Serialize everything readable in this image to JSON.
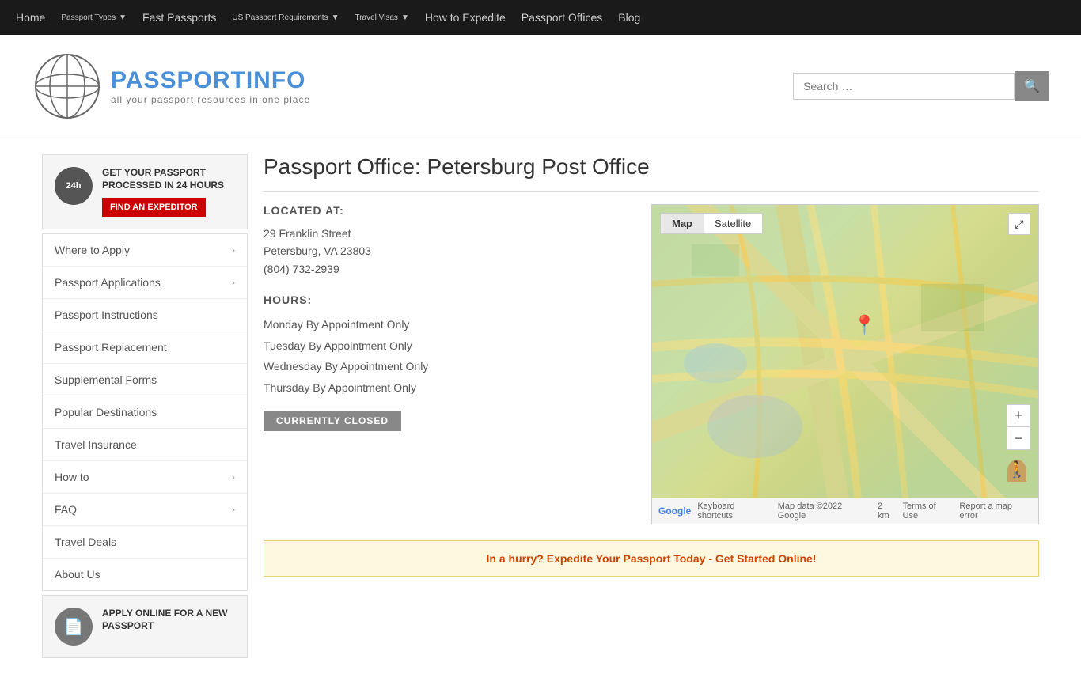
{
  "nav": {
    "items": [
      {
        "label": "Home",
        "hasDropdown": false
      },
      {
        "label": "Passport Types",
        "hasDropdown": true
      },
      {
        "label": "Fast Passports",
        "hasDropdown": false
      },
      {
        "label": "US Passport Requirements",
        "hasDropdown": true
      },
      {
        "label": "Travel Visas",
        "hasDropdown": true
      },
      {
        "label": "How to Expedite",
        "hasDropdown": false
      },
      {
        "label": "Passport Offices",
        "hasDropdown": false
      },
      {
        "label": "Blog",
        "hasDropdown": false
      }
    ]
  },
  "header": {
    "logo_text_1": "PASSPORT",
    "logo_text_2": "INFO",
    "logo_sub": "all your passport resources in one place",
    "search_placeholder": "Search …"
  },
  "sidebar": {
    "promo": {
      "title": "GET YOUR PASSPORT PROCESSED IN 24 HOURS",
      "button": "FIND AN EXPEDITOR"
    },
    "menu_items": [
      {
        "label": "Where to Apply",
        "hasDropdown": true
      },
      {
        "label": "Passport Applications",
        "hasDropdown": true
      },
      {
        "label": "Passport Instructions",
        "hasDropdown": false
      },
      {
        "label": "Passport Replacement",
        "hasDropdown": false
      },
      {
        "label": "Supplemental Forms",
        "hasDropdown": false
      },
      {
        "label": "Popular Destinations",
        "hasDropdown": false
      },
      {
        "label": "Travel Insurance",
        "hasDropdown": false
      },
      {
        "label": "How to",
        "hasDropdown": true
      },
      {
        "label": "FAQ",
        "hasDropdown": true
      },
      {
        "label": "Travel Deals",
        "hasDropdown": false
      },
      {
        "label": "About Us",
        "hasDropdown": false
      }
    ],
    "promo2": {
      "title": "APPLY ONLINE FOR A NEW PASSPORT"
    }
  },
  "content": {
    "page_title": "Passport Office: Petersburg Post Office",
    "location_label": "LOCATED AT:",
    "address_line1": "29 Franklin Street",
    "address_line2": "Petersburg, VA 23803",
    "phone": "(804) 732-2939",
    "hours_label": "HOURS:",
    "hours": [
      "Monday By Appointment Only",
      "Tuesday By Appointment Only",
      "Wednesday By Appointment Only",
      "Thursday By Appointment Only"
    ],
    "status": "CURRENTLY CLOSED",
    "map": {
      "tab_map": "Map",
      "tab_satellite": "Satellite",
      "footer_google": "Google",
      "footer_shortcuts": "Keyboard shortcuts",
      "footer_data": "Map data ©2022 Google",
      "footer_scale": "2 km",
      "footer_terms": "Terms of Use",
      "footer_report": "Report a map error"
    },
    "expedite_banner": "In a hurry? Expedite Your Passport Today - Get Started Online!"
  }
}
